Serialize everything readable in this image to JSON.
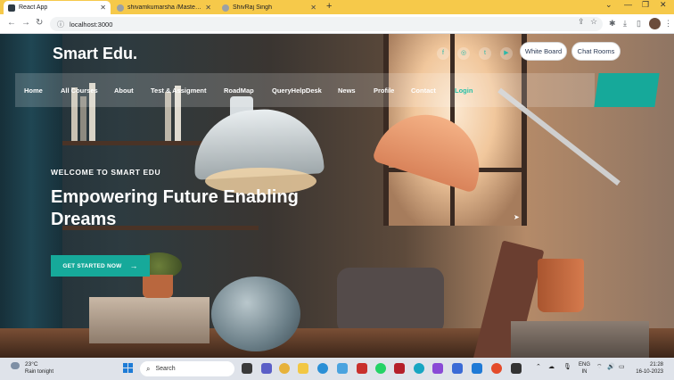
{
  "browser": {
    "tabs": [
      {
        "title": "React App",
        "favicon_color": "#2f3b45",
        "active": true
      },
      {
        "title": "shivamkumarsha /Master_shiv...",
        "favicon_color": "#9aa0a6",
        "active": false
      },
      {
        "title": "ShivRaj Singh",
        "favicon_color": "#9aa0a6",
        "active": false
      }
    ],
    "new_tab": "+",
    "url": "localhost:3000"
  },
  "site": {
    "brand": "Smart Edu.",
    "header_buttons": [
      "White Board",
      "Chat Rooms"
    ],
    "nav": [
      {
        "label": "Home",
        "accent": false
      },
      {
        "label": "All Courses",
        "accent": false
      },
      {
        "label": "About",
        "accent": false
      },
      {
        "label": "Test & Assigment",
        "accent": false
      },
      {
        "label": "RoadMap",
        "accent": false
      },
      {
        "label": "QueryHelpDesk",
        "accent": false
      },
      {
        "label": "News",
        "accent": false
      },
      {
        "label": "Profile",
        "accent": false
      },
      {
        "label": "Contact",
        "accent": false
      },
      {
        "label": "Login",
        "accent": true
      }
    ],
    "hero": {
      "kicker": "WELCOME TO SMART EDU",
      "title": "Empowering Future Enabling Dreams",
      "cta": "GET STARTED NOW",
      "cta_arrow": "→"
    },
    "accent_color": "#16a99a"
  },
  "taskbar": {
    "weather_temp": "23°C",
    "weather_desc": "Rain tonight",
    "search_placeholder": "Search",
    "lang_top": "ENG",
    "lang_bottom": "IN",
    "time": "21:28",
    "date": "16-10-2023"
  }
}
